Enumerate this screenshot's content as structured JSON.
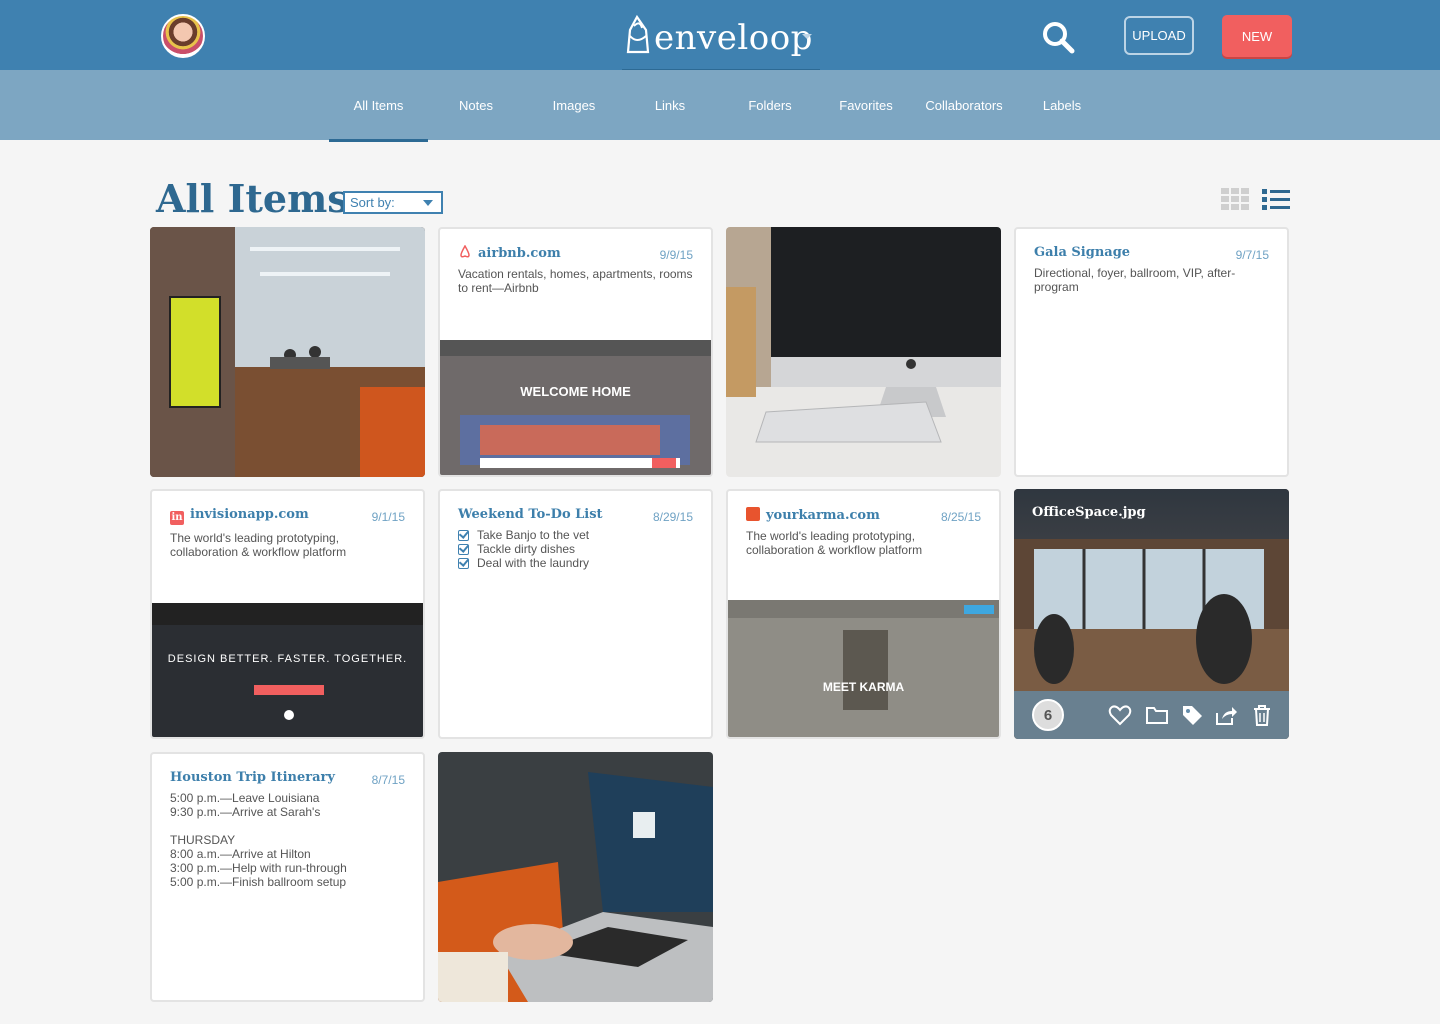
{
  "header": {
    "logo_text": "enveloop",
    "upload_label": "UPLOAD",
    "new_label": "NEW"
  },
  "nav": {
    "tabs": [
      {
        "label": "All Items",
        "active": true
      },
      {
        "label": "Notes"
      },
      {
        "label": "Images"
      },
      {
        "label": "Links"
      },
      {
        "label": "Folders"
      },
      {
        "label": "Favorites"
      },
      {
        "label": "Collaborators"
      },
      {
        "label": "Labels"
      }
    ]
  },
  "page": {
    "title": "All Items",
    "sort_label": "Sort by:"
  },
  "cards": {
    "airbnb": {
      "title": "airbnb.com",
      "date": "9/9/15",
      "desc": "Vacation rentals, homes, apartments, rooms to rent—Airbnb",
      "shot_headline": "WELCOME HOME"
    },
    "gala": {
      "title": "Gala Signage",
      "date": "9/7/15",
      "desc": "Directional, foyer, ballroom, VIP, after-program"
    },
    "invision": {
      "title": "invisionapp.com",
      "date": "9/1/15",
      "desc": "The world's leading prototyping, collaboration & workflow platform",
      "shot_headline": "DESIGN BETTER. FASTER. TOGETHER."
    },
    "todo": {
      "title": "Weekend To-Do List",
      "date": "8/29/15",
      "items": [
        "Take Banjo to the vet",
        "Tackle dirty dishes",
        "Deal with the laundry"
      ]
    },
    "karma": {
      "title": "yourkarma.com",
      "date": "8/25/15",
      "desc": "The world's leading prototyping, collaboration & workflow platform",
      "shot_headline": "MEET KARMA"
    },
    "officespace": {
      "title": "OfficeSpace.jpg",
      "count": "6"
    },
    "houston": {
      "title": "Houston Trip Itinerary",
      "date": "8/7/15",
      "lines": [
        "5:00 p.m.—Leave Louisiana",
        "9:30 p.m.—Arrive at Sarah's",
        "",
        "THURSDAY",
        "8:00 a.m.—Arrive at Hilton",
        "3:00 p.m.—Help with run-through",
        "5:00 p.m.—Finish ballroom setup"
      ]
    }
  },
  "colors": {
    "brand": "#3f81b0",
    "nav": "#7da6c2",
    "accent": "#f15f5f"
  }
}
